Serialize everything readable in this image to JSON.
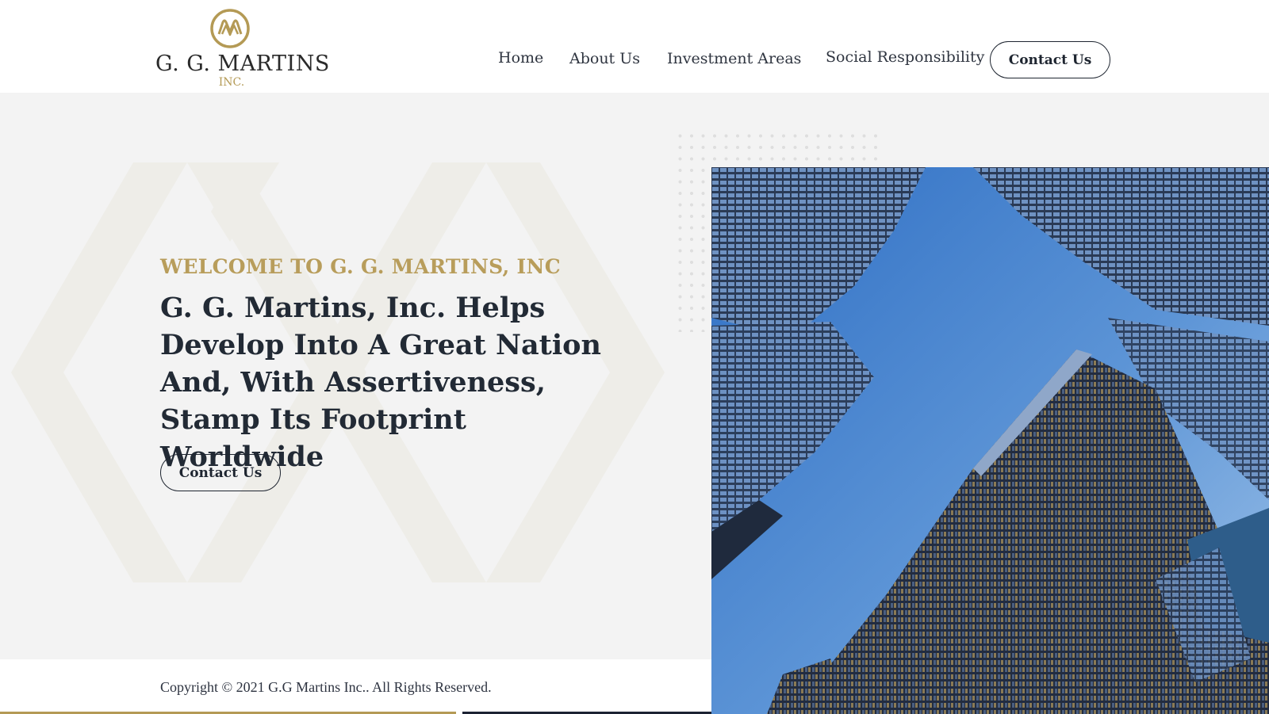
{
  "header": {
    "logo": {
      "name": "G. G. MARTINS",
      "suffix": "INC."
    },
    "nav": {
      "home": "Home",
      "about": "About Us",
      "investment": "Investment Areas",
      "social": "Social Responsibility",
      "contact": "Contact Us"
    }
  },
  "hero": {
    "welcome": "WELCOME TO G. G. MARTINS, INC",
    "headline": "G. G. Martins, Inc. Helps Develop Into A Great Nation And, With Assertiveness, Stamp Its Footprint Worldwide",
    "button": "Contact Us",
    "image_icon": "skyscrapers-photo"
  },
  "footer": {
    "copyright": "Copyright © 2021 G.G Martins Inc.. All Rights Reserved."
  },
  "colors": {
    "gold": "#b49a55",
    "navy": "#1e2530",
    "hero_bg": "#f3f3f3",
    "sky": "#4f86cc"
  }
}
